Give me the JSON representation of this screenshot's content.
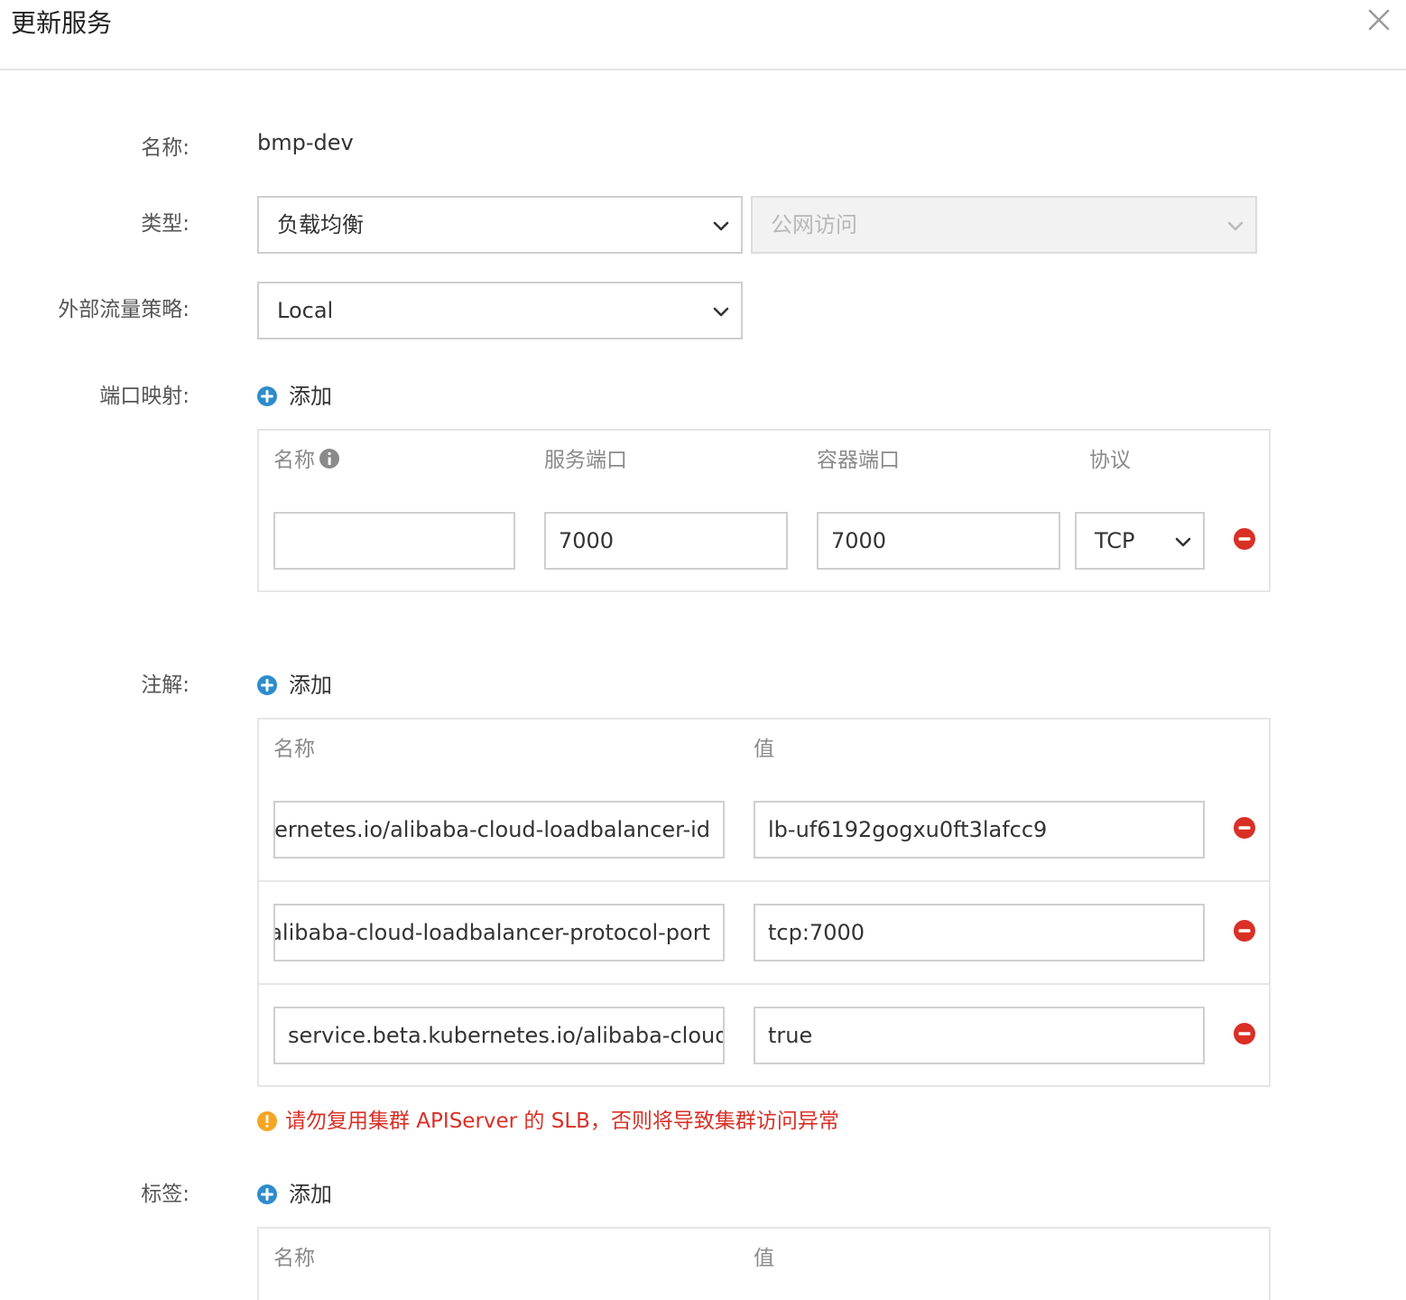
{
  "dialog": {
    "title": "更新服务",
    "close_icon": "close-icon"
  },
  "form": {
    "name_label": "名称:",
    "name_value": "bmp-dev",
    "type_label": "类型:",
    "type_value": "负载均衡",
    "access_value": "公网访问",
    "policy_label": "外部流量策略:",
    "policy_value": "Local",
    "add_label": "添加"
  },
  "port_mapping": {
    "label": "端口映射:",
    "headers": {
      "name": "名称",
      "service_port": "服务端口",
      "container_port": "容器端口",
      "protocol": "协议"
    },
    "rows": [
      {
        "name": "",
        "service_port": "7000",
        "container_port": "7000",
        "protocol": "TCP"
      }
    ]
  },
  "annotations": {
    "label": "注解:",
    "headers": {
      "name": "名称",
      "value": "值"
    },
    "rows": [
      {
        "name": "service.beta.kubernetes.io/alibaba-cloud-loadbalancer-id",
        "value": "lb-uf6192gogxu0ft3lafcc9"
      },
      {
        "name": "service.beta.kubernetes.io/alibaba-cloud-loadbalancer-protocol-port",
        "value": "tcp:7000"
      },
      {
        "name": "service.beta.kubernetes.io/alibaba-cloud-",
        "value": "true"
      }
    ],
    "warning": "请勿复用集群 APIServer 的 SLB，否则将导致集群访问异常"
  },
  "labels": {
    "label": "标签:",
    "headers": {
      "name": "名称",
      "value": "值"
    }
  },
  "colors": {
    "accent": "#2d8ccc",
    "danger": "#d93026",
    "warning_icon": "#f5a623"
  }
}
